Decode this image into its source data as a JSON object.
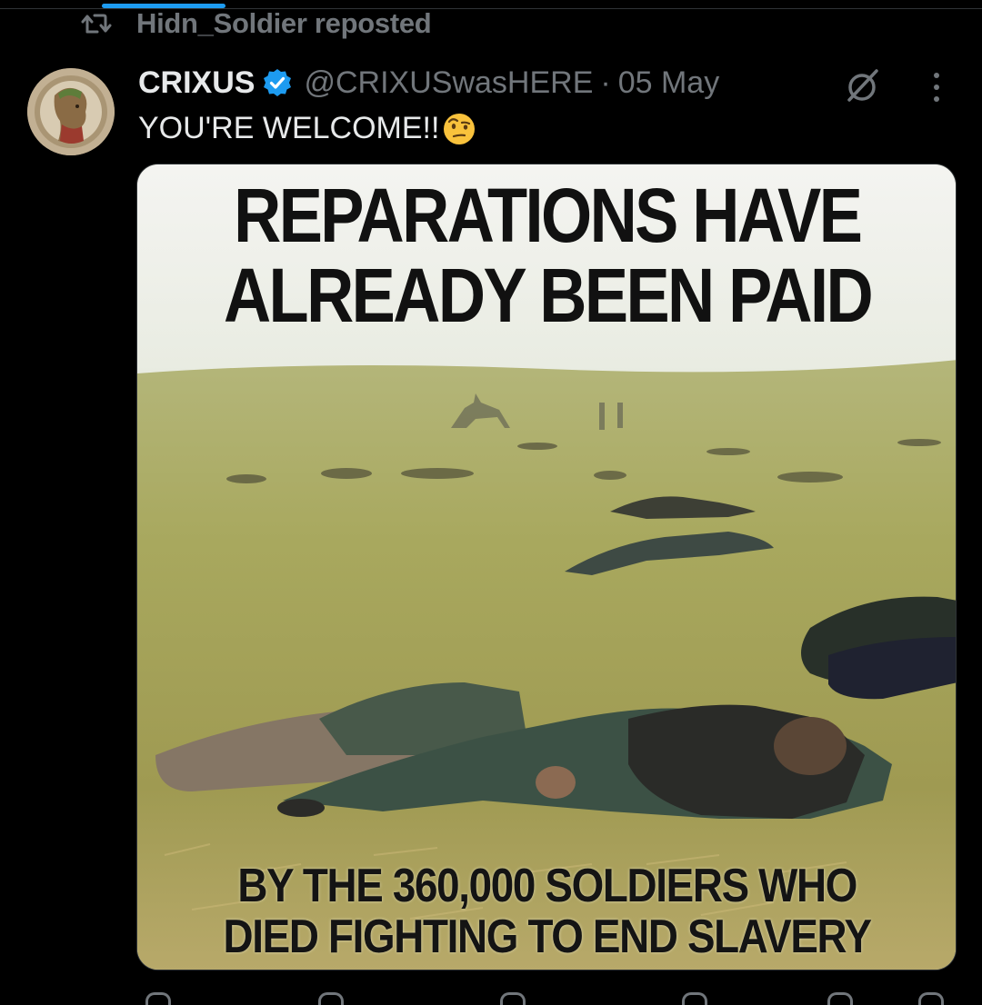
{
  "repost": {
    "icon": "repost-icon",
    "text": "Hidn_Soldier reposted"
  },
  "tweet": {
    "author_name": "CRIXUS",
    "verified": true,
    "handle": "@CRIXUSwasHERE",
    "separator": "·",
    "date": "05 May",
    "text": "YOU'RE WELCOME!!",
    "emoji": "face-with-raised-eyebrow-emoji",
    "media": {
      "description_icon": "battlefield-photo",
      "headline_line1": "REPARATIONS HAVE",
      "headline_line2": "ALREADY BEEN PAID",
      "caption_line1": "BY THE 360,000 SOLDIERS WHO",
      "caption_line2": "DIED FIGHTING TO END SLAVERY"
    }
  },
  "colors": {
    "background": "#000000",
    "text_primary": "#e7e9ea",
    "text_secondary": "#71767b",
    "accent": "#1d9bf0"
  },
  "icons": [
    "repost-icon",
    "verified-badge-icon",
    "grok-icon",
    "more-options-icon"
  ]
}
